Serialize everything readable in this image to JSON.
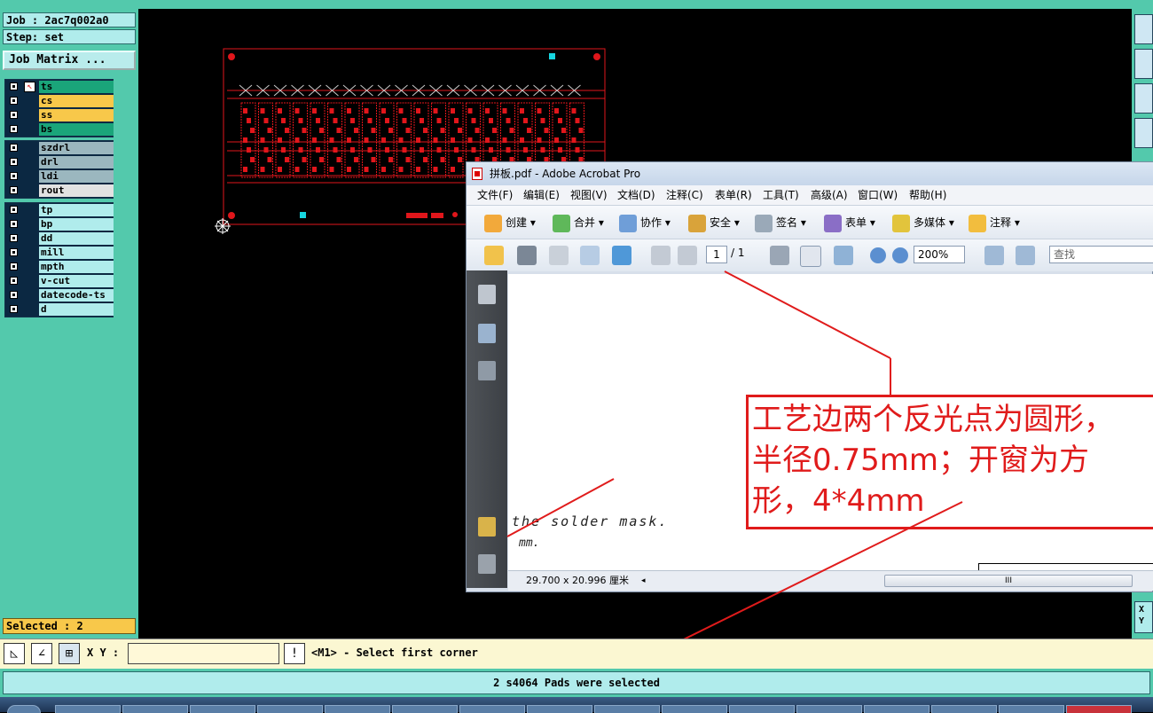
{
  "job": {
    "job_label": "Job : 2ac7q002a0",
    "step_label": "Step: set",
    "matrix_button": "Job Matrix ..."
  },
  "layers": {
    "group1": [
      {
        "name": "ts",
        "color": "#1aa57a"
      },
      {
        "name": "cs",
        "color": "#f8c84a"
      },
      {
        "name": "ss",
        "color": "#f8c84a"
      },
      {
        "name": "bs",
        "color": "#1aa57a"
      }
    ],
    "group2": [
      {
        "name": "szdrl",
        "color": "#9bb7bf"
      },
      {
        "name": "drl",
        "color": "#9bb7bf"
      },
      {
        "name": "ldi",
        "color": "#9bb7bf"
      },
      {
        "name": "rout",
        "color": "#e2e2e2"
      }
    ],
    "group3": [
      {
        "name": "tp",
        "color": "#b0ecec"
      },
      {
        "name": "bp",
        "color": "#b0ecec"
      },
      {
        "name": "dd",
        "color": "#b0ecec"
      },
      {
        "name": "mill",
        "color": "#b0ecec"
      },
      {
        "name": "mpth",
        "color": "#b0ecec"
      },
      {
        "name": "v-cut",
        "color": "#b0ecec"
      },
      {
        "name": "datecode-ts",
        "color": "#b0ecec"
      },
      {
        "name": "d",
        "color": "#b0ecec"
      }
    ]
  },
  "selected_label": "Selected : 2",
  "right_strip": {
    "xy_label_x": "X",
    "xy_label_y": "Y"
  },
  "cmdbar": {
    "xy_label": "X Y :",
    "xy_value": "",
    "alert_glyph": "!",
    "prompt": "<M1> - Select first corner"
  },
  "status": "2 s4064 Pads were selected",
  "acrobat": {
    "title": "拼板.pdf - Adobe Acrobat Pro",
    "menus": [
      "文件(F)",
      "编辑(E)",
      "视图(V)",
      "文档(D)",
      "注释(C)",
      "表单(R)",
      "工具(T)",
      "高级(A)",
      "窗口(W)",
      "帮助(H)"
    ],
    "toolbar1": [
      "创建 ▾",
      "合并 ▾",
      "协作 ▾",
      "安全 ▾",
      "签名 ▾",
      "表单 ▾",
      "多媒体 ▾",
      "注释 ▾"
    ],
    "page_current": "1",
    "page_total": "/ 1",
    "zoom": "200%",
    "find_placeholder": "查找",
    "doc_text_1": "the solder mask.",
    "doc_text_2": "mm.",
    "page_size": "29.700 x 20.996 厘米",
    "scroll_grip": "III"
  },
  "annotation_text": "工艺边两个反光点为圆形，\n半径0.75mm；开窗为方\n形，4*4mm",
  "colors": {
    "accent_red": "#e01b1b",
    "panel_teal": "#53c9ac",
    "cyan_pad": "#16d6e0"
  }
}
